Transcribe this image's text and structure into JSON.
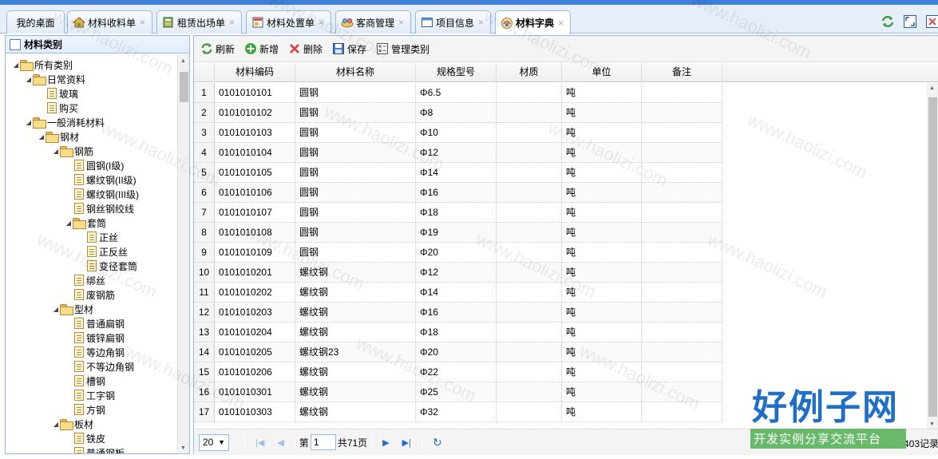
{
  "tabs": [
    {
      "label": "我的桌面",
      "icon": "none",
      "closable": false
    },
    {
      "label": "材料收料单",
      "icon": "house-icon",
      "closable": true
    },
    {
      "label": "租赁出场单",
      "icon": "ledger-icon",
      "closable": true
    },
    {
      "label": "材料处置单",
      "icon": "form-icon",
      "closable": true
    },
    {
      "label": "客商管理",
      "icon": "people-icon",
      "closable": true
    },
    {
      "label": "项目信息",
      "icon": "window-icon",
      "closable": true
    },
    {
      "label": "材料字典",
      "icon": "dictionary-icon",
      "closable": true,
      "active": true
    }
  ],
  "tab_close": "×",
  "tree_panel": {
    "title": "材料类别"
  },
  "tree": [
    {
      "label": "所有类别",
      "type": "folder",
      "expanded": true,
      "level": 0
    },
    {
      "label": "日常资料",
      "type": "folder",
      "expanded": true,
      "level": 1
    },
    {
      "label": "玻璃",
      "type": "file",
      "level": 2
    },
    {
      "label": "购买",
      "type": "file",
      "level": 2
    },
    {
      "label": "一般消耗材料",
      "type": "folder",
      "expanded": true,
      "level": 1
    },
    {
      "label": "钢材",
      "type": "folder",
      "expanded": true,
      "level": 2
    },
    {
      "label": "钢筋",
      "type": "folder",
      "expanded": true,
      "level": 3
    },
    {
      "label": "圆钢(I级)",
      "type": "file",
      "level": 4
    },
    {
      "label": "螺纹钢(II级)",
      "type": "file",
      "level": 4
    },
    {
      "label": "螺纹钢(III级)",
      "type": "file",
      "level": 4
    },
    {
      "label": "钢丝钢绞线",
      "type": "file",
      "level": 4
    },
    {
      "label": "套筒",
      "type": "folder",
      "expanded": true,
      "level": 4
    },
    {
      "label": "正丝",
      "type": "file",
      "level": 5
    },
    {
      "label": "正反丝",
      "type": "file",
      "level": 5
    },
    {
      "label": "变径套筒",
      "type": "file",
      "level": 5
    },
    {
      "label": "绑丝",
      "type": "file",
      "level": 4
    },
    {
      "label": "废钢筋",
      "type": "file",
      "level": 4
    },
    {
      "label": "型材",
      "type": "folder",
      "expanded": true,
      "level": 3
    },
    {
      "label": "普通扁钢",
      "type": "file",
      "level": 4
    },
    {
      "label": "镀锌扁钢",
      "type": "file",
      "level": 4
    },
    {
      "label": "等边角钢",
      "type": "file",
      "level": 4
    },
    {
      "label": "不等边角钢",
      "type": "file",
      "level": 4
    },
    {
      "label": "槽钢",
      "type": "file",
      "level": 4
    },
    {
      "label": "工字钢",
      "type": "file",
      "level": 4
    },
    {
      "label": "方钢",
      "type": "file",
      "level": 4
    },
    {
      "label": "板材",
      "type": "folder",
      "expanded": true,
      "level": 3
    },
    {
      "label": "铁皮",
      "type": "file",
      "level": 4
    },
    {
      "label": "普通钢板",
      "type": "file",
      "level": 4
    }
  ],
  "toolbar": {
    "refresh": "刷新",
    "add": "新增",
    "delete": "删除",
    "save": "保存",
    "manage": "管理类别"
  },
  "grid": {
    "columns": [
      "材料编码",
      "材料名称",
      "规格型号",
      "材质",
      "单位",
      "备注"
    ],
    "rows": [
      [
        "1",
        "0101010101",
        "圆钢",
        "Φ6.5",
        "",
        "吨",
        ""
      ],
      [
        "2",
        "0101010102",
        "圆钢",
        "Φ8",
        "",
        "吨",
        ""
      ],
      [
        "3",
        "0101010103",
        "圆钢",
        "Φ10",
        "",
        "吨",
        ""
      ],
      [
        "4",
        "0101010104",
        "圆钢",
        "Φ12",
        "",
        "吨",
        ""
      ],
      [
        "5",
        "0101010105",
        "圆钢",
        "Φ14",
        "",
        "吨",
        ""
      ],
      [
        "6",
        "0101010106",
        "圆钢",
        "Φ16",
        "",
        "吨",
        ""
      ],
      [
        "7",
        "0101010107",
        "圆钢",
        "Φ18",
        "",
        "吨",
        ""
      ],
      [
        "8",
        "0101010108",
        "圆钢",
        "Φ19",
        "",
        "吨",
        ""
      ],
      [
        "9",
        "0101010109",
        "圆钢",
        "Φ20",
        "",
        "吨",
        ""
      ],
      [
        "10",
        "0101010201",
        "螺纹钢",
        "Φ12",
        "",
        "吨",
        ""
      ],
      [
        "11",
        "0101010202",
        "螺纹钢",
        "Φ14",
        "",
        "吨",
        ""
      ],
      [
        "12",
        "0101010203",
        "螺纹钢",
        "Φ16",
        "",
        "吨",
        ""
      ],
      [
        "13",
        "0101010204",
        "螺纹钢",
        "Φ18",
        "",
        "吨",
        ""
      ],
      [
        "14",
        "0101010205",
        "螺纹钢23",
        "Φ20",
        "",
        "吨",
        ""
      ],
      [
        "15",
        "0101010206",
        "螺纹钢",
        "Φ22",
        "",
        "吨",
        ""
      ],
      [
        "16",
        "0101010301",
        "螺纹钢",
        "Φ25",
        "",
        "吨",
        ""
      ],
      [
        "17",
        "0101010303",
        "螺纹钢",
        "Φ32",
        "",
        "吨",
        ""
      ]
    ]
  },
  "pager": {
    "page_size": "20",
    "page_prefix": "第",
    "page_value": "1",
    "total_pages": "共71页",
    "records": "403记录"
  },
  "watermark": {
    "site": "www.haolizi.com",
    "logo_big": "好例子网",
    "logo_small": "开发实例分享交流平台"
  },
  "colors": {
    "border": "#95b8e7",
    "header_bg": "#e0ecff",
    "topbar": "#3d7fd9",
    "pager_icon": "#1f6fd1",
    "logo_blue": "#1f6fc9",
    "logo_green": "#68b96a"
  }
}
